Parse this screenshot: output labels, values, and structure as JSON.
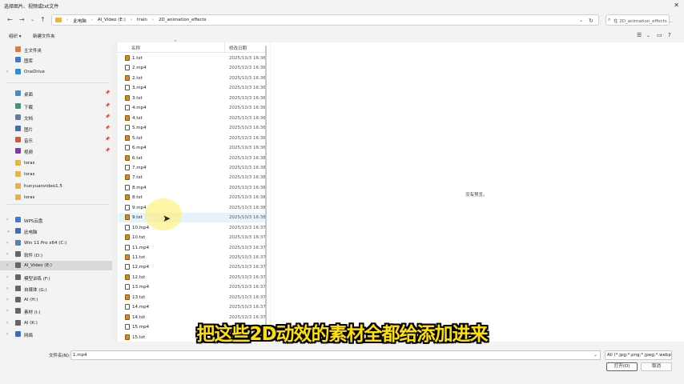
{
  "window": {
    "title": "选择图片、视频或txt文件"
  },
  "address": {
    "crumbs": [
      "此电脑",
      "AI_Video (E:)",
      "train",
      "2D_animation_effects"
    ],
    "search_placeholder": "在 2D_animation_effects ..."
  },
  "toolbar": {
    "organize": "组织 ▾",
    "new_folder": "新建文件夹"
  },
  "sidebar": {
    "items": [
      {
        "label": "主文件夹",
        "icon": "home-icon",
        "color": "#e07a3a",
        "chev": "",
        "pin": false
      },
      {
        "label": "图库",
        "icon": "gallery-icon",
        "color": "#3a7be0",
        "chev": "",
        "pin": false
      },
      {
        "label": "OneDrive",
        "icon": "cloud-icon",
        "color": "#2a8de0",
        "chev": "›",
        "pin": false
      },
      {
        "label": "桌面",
        "icon": "desktop-icon",
        "color": "#3a8fd9",
        "chev": "",
        "pin": true
      },
      {
        "label": "下载",
        "icon": "download-icon",
        "color": "#2f9e6a",
        "chev": "",
        "pin": true
      },
      {
        "label": "文档",
        "icon": "document-icon",
        "color": "#5a7fa8",
        "chev": "",
        "pin": true
      },
      {
        "label": "图片",
        "icon": "picture-icon",
        "color": "#3a6fb8",
        "chev": "",
        "pin": true
      },
      {
        "label": "音乐",
        "icon": "music-icon",
        "color": "#e0523a",
        "chev": "",
        "pin": true
      },
      {
        "label": "视频",
        "icon": "video-icon",
        "color": "#7a3ab8",
        "chev": "",
        "pin": true
      },
      {
        "label": "loras",
        "icon": "folder-icon",
        "color": "#e8b43a",
        "chev": "",
        "pin": false
      },
      {
        "label": "loras",
        "icon": "folder-icon",
        "color": "#e8b43a",
        "chev": "",
        "pin": false
      },
      {
        "label": "hunyuanvideo1.5",
        "icon": "folder-icon",
        "color": "#e8b43a",
        "chev": "",
        "pin": false
      },
      {
        "label": "loras",
        "icon": "folder-icon",
        "color": "#e8b43a",
        "chev": "",
        "pin": false
      },
      {
        "label": "WPS云盘",
        "icon": "cloud-drive-icon",
        "color": "#3a7be0",
        "chev": "›",
        "pin": false
      },
      {
        "label": "此电脑",
        "icon": "computer-icon",
        "color": "#3a6fb8",
        "chev": "⌄",
        "pin": false
      },
      {
        "label": "Win 11 Pro x64 (C:)",
        "icon": "drive-icon",
        "color": "#5a7fa8",
        "chev": "›",
        "pin": false
      },
      {
        "label": "软件 (D:)",
        "icon": "drive-icon",
        "color": "#666666",
        "chev": "›",
        "pin": false
      },
      {
        "label": "AI_Video (E:)",
        "icon": "drive-icon",
        "color": "#666666",
        "chev": "›",
        "pin": false,
        "selected": true
      },
      {
        "label": "模型训练 (F:)",
        "icon": "drive-icon",
        "color": "#666666",
        "chev": "›",
        "pin": false
      },
      {
        "label": "自媒体 (G:)",
        "icon": "drive-icon",
        "color": "#666666",
        "chev": "›",
        "pin": false
      },
      {
        "label": "AI (H:)",
        "icon": "drive-icon",
        "color": "#666666",
        "chev": "›",
        "pin": false
      },
      {
        "label": "素材 (I:)",
        "icon": "drive-icon",
        "color": "#666666",
        "chev": "›",
        "pin": false
      },
      {
        "label": "AI (K:)",
        "icon": "drive-icon",
        "color": "#666666",
        "chev": "›",
        "pin": false
      },
      {
        "label": "网络",
        "icon": "network-icon",
        "color": "#3a6fb8",
        "chev": "›",
        "pin": false
      }
    ]
  },
  "filelist": {
    "col_name": "名称",
    "col_date": "修改日期",
    "files": [
      {
        "name": "1.txt",
        "date": "2025/10/3 16:36",
        "type": "txt"
      },
      {
        "name": "2.mp4",
        "date": "2025/10/3 16:36",
        "type": "mp4"
      },
      {
        "name": "2.txt",
        "date": "2025/10/3 16:36",
        "type": "txt"
      },
      {
        "name": "3.mp4",
        "date": "2025/10/3 16:36",
        "type": "mp4"
      },
      {
        "name": "3.txt",
        "date": "2025/10/3 16:36",
        "type": "txt"
      },
      {
        "name": "4.mp4",
        "date": "2025/10/3 16:36",
        "type": "mp4"
      },
      {
        "name": "4.txt",
        "date": "2025/10/3 16:36",
        "type": "txt"
      },
      {
        "name": "5.mp4",
        "date": "2025/10/3 16:36",
        "type": "mp4"
      },
      {
        "name": "5.txt",
        "date": "2025/10/3 16:36",
        "type": "txt"
      },
      {
        "name": "6.mp4",
        "date": "2025/10/3 16:36",
        "type": "mp4"
      },
      {
        "name": "6.txt",
        "date": "2025/10/3 16:38",
        "type": "txt"
      },
      {
        "name": "7.mp4",
        "date": "2025/10/3 16:38",
        "type": "mp4"
      },
      {
        "name": "7.txt",
        "date": "2025/10/3 16:38",
        "type": "txt"
      },
      {
        "name": "8.mp4",
        "date": "2025/10/3 16:38",
        "type": "mp4"
      },
      {
        "name": "8.txt",
        "date": "2025/10/3 16:38",
        "type": "txt"
      },
      {
        "name": "9.mp4",
        "date": "2025/10/3 16:38",
        "type": "mp4"
      },
      {
        "name": "9.txt",
        "date": "2025/10/3 16:38",
        "type": "txt",
        "hover": true
      },
      {
        "name": "10.mp4",
        "date": "2025/10/3 16:37",
        "type": "mp4"
      },
      {
        "name": "10.txt",
        "date": "2025/10/3 16:37",
        "type": "txt"
      },
      {
        "name": "11.mp4",
        "date": "2025/10/3 16:37",
        "type": "mp4"
      },
      {
        "name": "11.txt",
        "date": "2025/10/3 16:37",
        "type": "txt"
      },
      {
        "name": "12.mp4",
        "date": "2025/10/3 16:37",
        "type": "mp4"
      },
      {
        "name": "12.txt",
        "date": "2025/10/3 16:37",
        "type": "txt"
      },
      {
        "name": "13.mp4",
        "date": "2025/10/3 16:37",
        "type": "mp4"
      },
      {
        "name": "13.txt",
        "date": "2025/10/3 16:37",
        "type": "txt"
      },
      {
        "name": "14.mp4",
        "date": "2025/10/3 16:37",
        "type": "mp4"
      },
      {
        "name": "14.txt",
        "date": "2025/10/3 16:37",
        "type": "txt"
      },
      {
        "name": "15.mp4",
        "date": "2025/10/3 16:37",
        "type": "mp4"
      },
      {
        "name": "15.txt",
        "date": "2025/10/3 16:37",
        "type": "txt"
      }
    ]
  },
  "preview": {
    "message": "没有预览。"
  },
  "bottom": {
    "filename_label": "文件名(N):",
    "filename_value": "1.mp4",
    "filetype_value": "All (*.jpg;*.png;*.jpeg;*.webp",
    "open_button": "打开(O)",
    "cancel_button": "取消"
  },
  "subtitle": "把这些2D动效的素材全都给添加进来"
}
